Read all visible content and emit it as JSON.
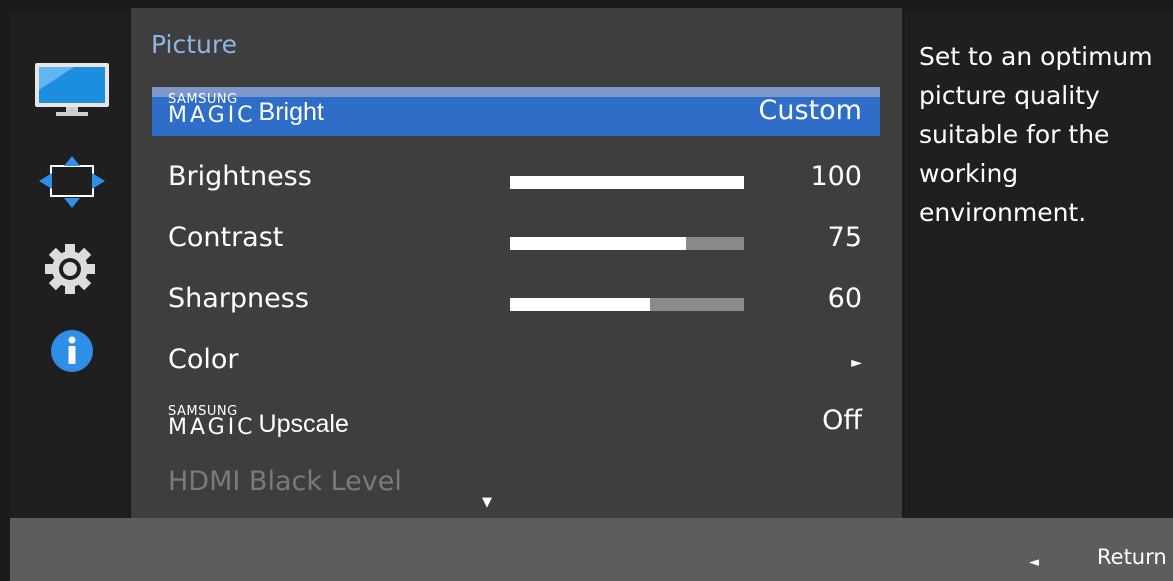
{
  "sidebar": {
    "icons": [
      "monitor-icon",
      "resize-arrows-icon",
      "gear-icon",
      "info-icon"
    ]
  },
  "menu": {
    "title": "Picture",
    "items": [
      {
        "logo_top": "SAMSUNG",
        "logo_bottom": "MAGIC",
        "label": "Bright",
        "value": "Custom",
        "selected": true
      },
      {
        "label": "Brightness",
        "value": "100",
        "level": 100
      },
      {
        "label": "Contrast",
        "value": "75",
        "level": 75
      },
      {
        "label": "Sharpness",
        "value": "60",
        "level": 60
      },
      {
        "label": "Color",
        "value": "►"
      },
      {
        "logo_top": "SAMSUNG",
        "logo_bottom": "MAGIC",
        "label": "Upscale",
        "value": "Off"
      },
      {
        "label": "HDMI Black Level",
        "disabled": true
      }
    ],
    "scroll_indicator": "▼"
  },
  "help": {
    "text": "Set to an optimum picture quality suitable for the working environment."
  },
  "footer": {
    "return_arrow": "◄",
    "return_label": "Return"
  },
  "colors": {
    "selection": "#2f6ec8",
    "title": "#8fb4e8",
    "panel": "#3e3e3e"
  }
}
